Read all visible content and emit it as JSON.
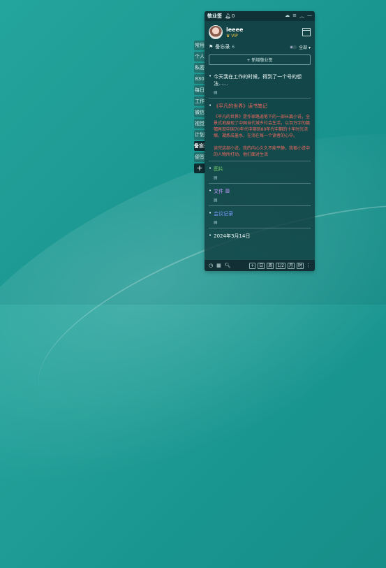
{
  "window": {
    "title": "敬业签",
    "bell_count": "0"
  },
  "user": {
    "name": "leeee",
    "badge": "VIP"
  },
  "notebook": {
    "label": "备忘录",
    "count": "6",
    "filter": "全部"
  },
  "new_button": "+ 新增敬业签",
  "side_tabs": [
    "常用",
    "个人",
    "私密",
    "830",
    "每日",
    "工作",
    "微信",
    "视觉",
    "计划",
    "备忘录",
    "便签"
  ],
  "notes": [
    {
      "title": "今天我在工作的时候，得到了一个号的想法......",
      "color": "white",
      "body": "",
      "has_icon": true
    },
    {
      "title": "《平凡的世界》读书笔记",
      "color": "red",
      "body": "《平凡的世界》是作家路遥笔下的一部长篇小说，全景式地展现了中国当代城乡社会生活，以百万字的篇幅再现中国70年代中期到80年代中期的十年时光浓缩，凝炼成墨水，在淌在每一个读者的心中。\n\n读完这部小说，我的内心久久不能平静，我被小说中的人物所打动，他们面对生活",
      "has_icon": false
    },
    {
      "title": "图片",
      "color": "green",
      "body": "",
      "has_icon": true
    },
    {
      "title": "文件",
      "color": "purple",
      "body": "",
      "has_icon": true
    },
    {
      "title": "会议记录",
      "color": "blue",
      "body": "",
      "has_icon": true
    },
    {
      "title": "2024年3月14日",
      "color": "white",
      "body": "",
      "has_icon": false
    }
  ],
  "bottom_buttons": [
    "日",
    "周",
    "1/2",
    "月",
    "时"
  ]
}
